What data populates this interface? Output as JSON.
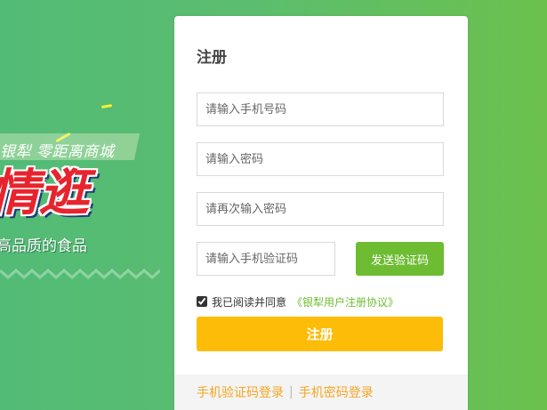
{
  "promo": {
    "ribbon_text": "银犁  零距离商城",
    "headline": "情逛",
    "subline": "高品质的食品"
  },
  "register": {
    "title": "注册",
    "phone_placeholder": "请输入手机号码",
    "password_placeholder": "请输入密码",
    "confirm_password_placeholder": "请再次输入密码",
    "sms_code_placeholder": "请输入手机验证码",
    "send_code_label": "发送验证码",
    "agree_checked": true,
    "agree_text": "我已阅读并同意",
    "agreement_link": "《银犁用户注册协议》",
    "submit_label": "注册"
  },
  "footer": {
    "sms_login": "手机验证码登录",
    "separator": "|",
    "password_login": "手机密码登录"
  },
  "colors": {
    "bg_green": "#5bbd6f",
    "send_button": "#6dbc32",
    "submit_button": "#fdbc07",
    "footer_link": "#f5a623",
    "agreement_link": "#6dbc32"
  }
}
